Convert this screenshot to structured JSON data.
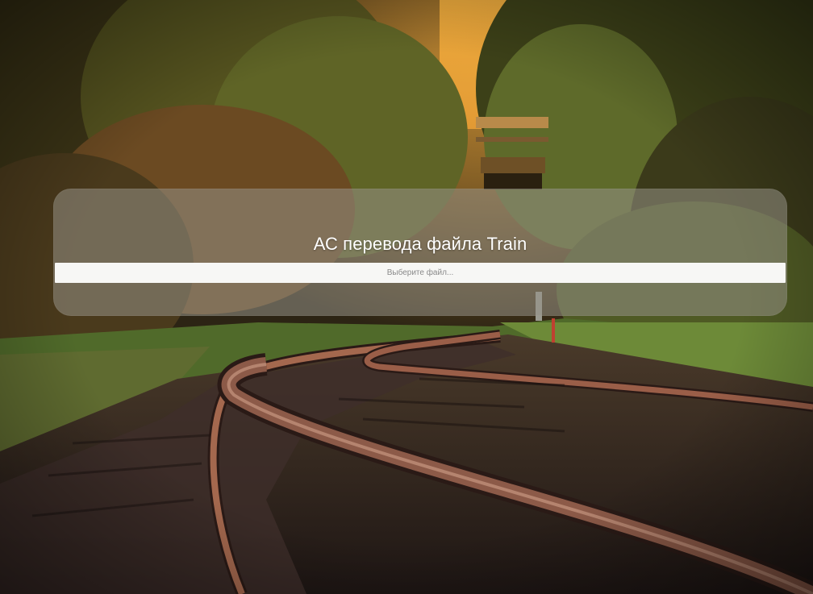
{
  "page": {
    "title": "АС перевода файла Train"
  },
  "file_input": {
    "placeholder": "Выберите файл..."
  },
  "background": {
    "subject": "railway-tracks-through-forest",
    "colors": {
      "sky": "#f2b84a",
      "foliage": "#4f5a22",
      "rail": "#7a3c2a",
      "ballast": "#3a2a26"
    }
  }
}
